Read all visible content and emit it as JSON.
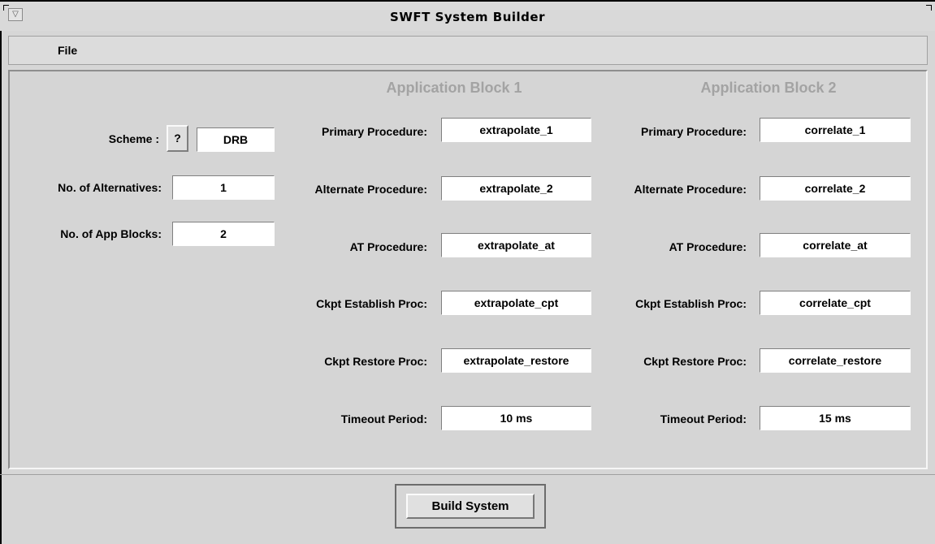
{
  "window": {
    "title": "SWFT System Builder",
    "menu_icon": "triangle-down-icon"
  },
  "menubar": {
    "file_label": "File"
  },
  "left_panel": {
    "scheme_label": "Scheme :",
    "scheme_help_label": "?",
    "scheme_value": "DRB",
    "alternatives_label": "No. of Alternatives:",
    "alternatives_value": "1",
    "app_blocks_label": "No. of App Blocks:",
    "app_blocks_value": "2"
  },
  "blocks": [
    {
      "header": "Application Block 1",
      "primary_label": "Primary Procedure:",
      "primary_value": "extrapolate_1",
      "alternate_label": "Alternate Procedure:",
      "alternate_value": "extrapolate_2",
      "at_label": "AT Procedure:",
      "at_value": "extrapolate_at",
      "ckpt_establish_label": "Ckpt Establish Proc:",
      "ckpt_establish_value": "extrapolate_cpt",
      "ckpt_restore_label": "Ckpt Restore Proc:",
      "ckpt_restore_value": "extrapolate_restore",
      "timeout_label": "Timeout Period:",
      "timeout_value": "10 ms"
    },
    {
      "header": "Application Block 2",
      "primary_label": "Primary Procedure:",
      "primary_value": "correlate_1",
      "alternate_label": "Alternate Procedure:",
      "alternate_value": "correlate_2",
      "at_label": "AT Procedure:",
      "at_value": "correlate_at",
      "ckpt_establish_label": "Ckpt Establish Proc:",
      "ckpt_establish_value": "correlate_cpt",
      "ckpt_restore_label": "Ckpt Restore Proc:",
      "ckpt_restore_value": "correlate_restore",
      "timeout_label": "Timeout Period:",
      "timeout_value": "15 ms"
    }
  ],
  "footer": {
    "build_label": "Build System"
  }
}
